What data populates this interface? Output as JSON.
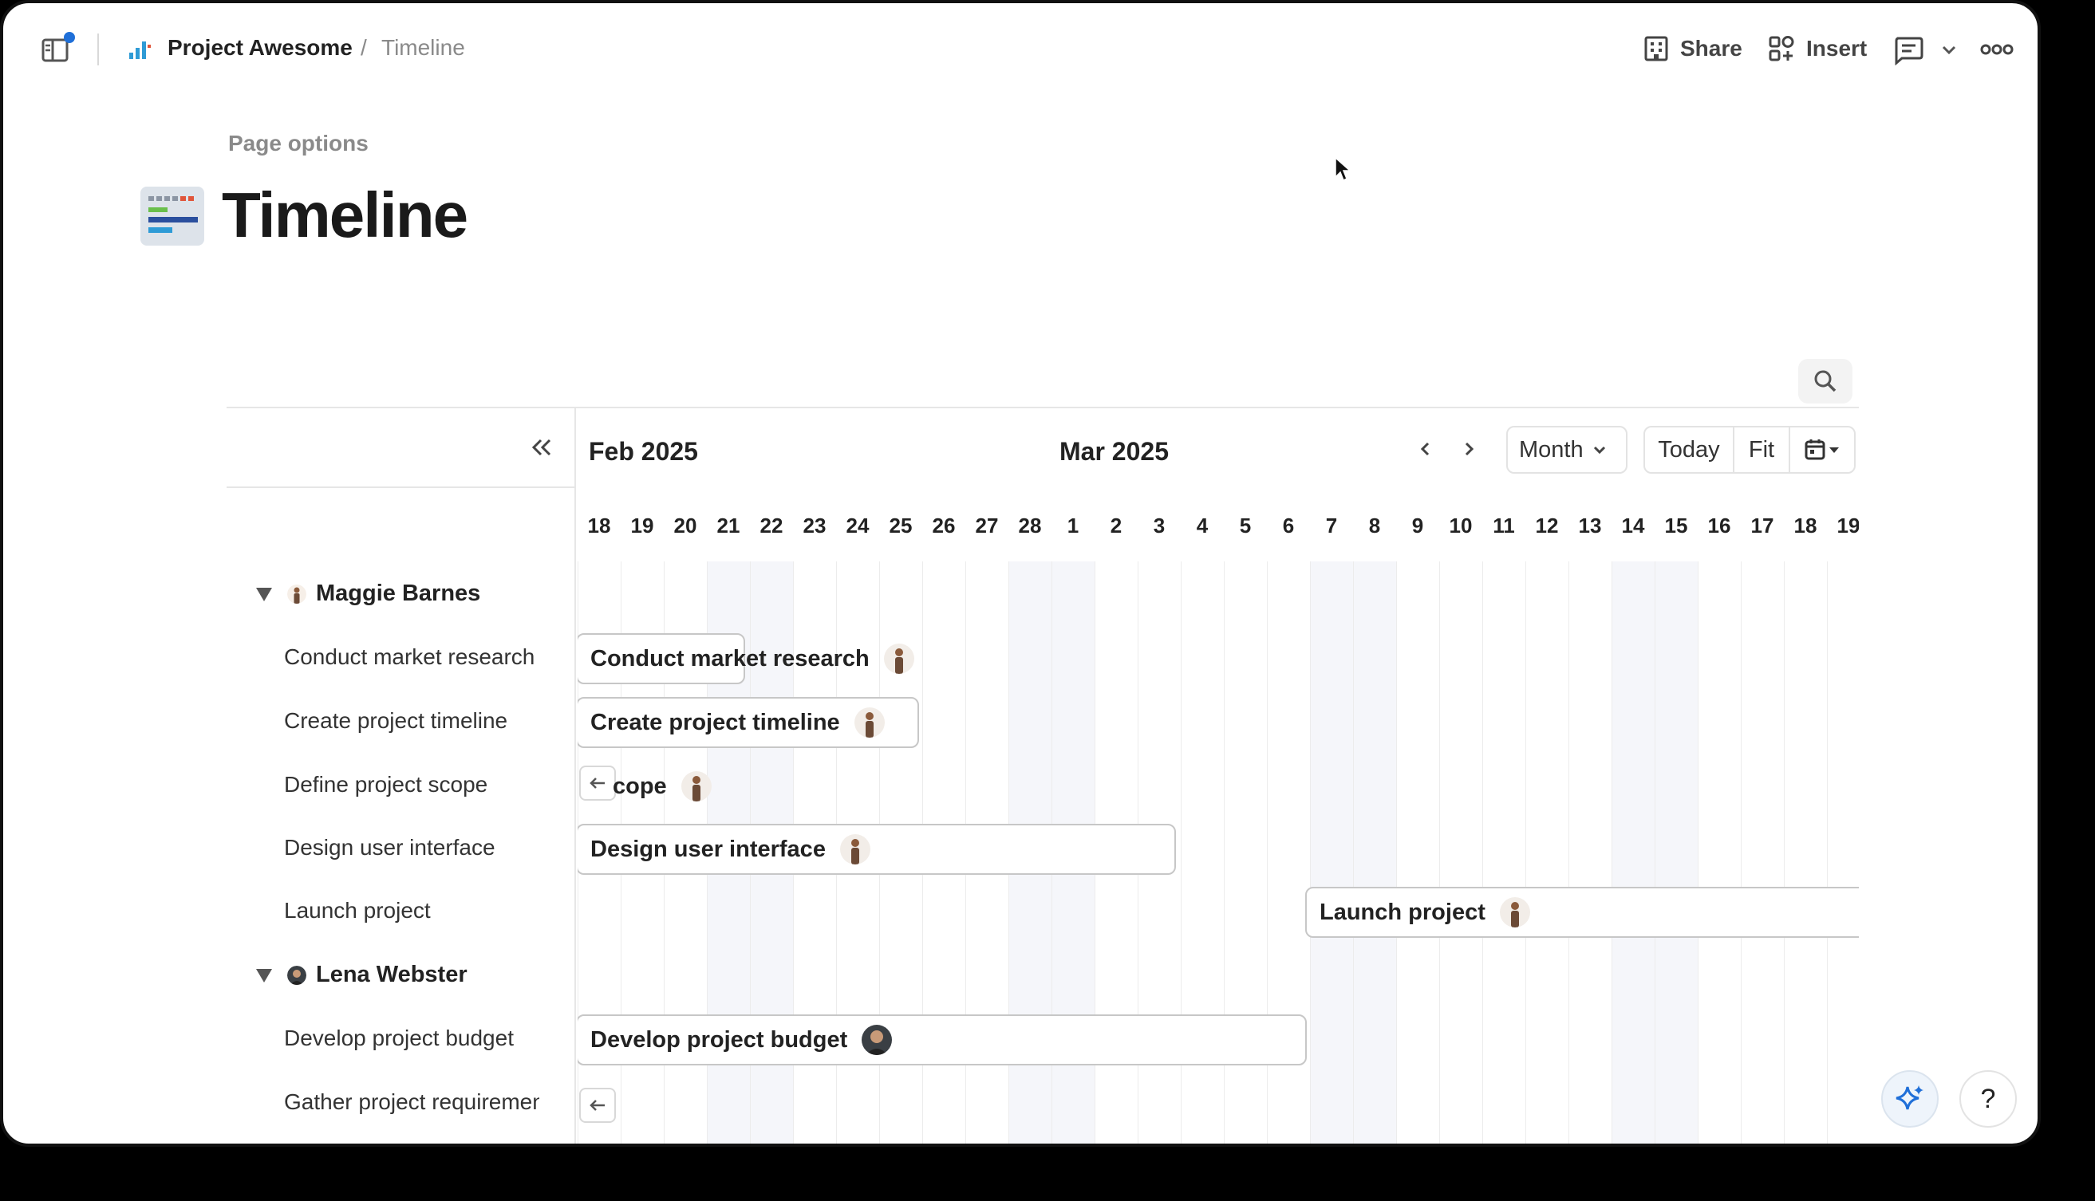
{
  "breadcrumb": {
    "project": "Project Awesome",
    "separator": "/",
    "page": "Timeline"
  },
  "topbar": {
    "share_label": "Share",
    "insert_label": "Insert"
  },
  "page": {
    "options_label": "Page options",
    "title": "Timeline"
  },
  "timeline": {
    "month_left": "Feb 2025",
    "month_right": "Mar 2025",
    "view_select": "Month",
    "today_label": "Today",
    "fit_label": "Fit",
    "days": [
      "18",
      "19",
      "20",
      "21",
      "22",
      "23",
      "24",
      "25",
      "26",
      "27",
      "28",
      "1",
      "2",
      "3",
      "4",
      "5",
      "6",
      "7",
      "8",
      "9",
      "10",
      "11",
      "12",
      "13",
      "14",
      "15",
      "16",
      "17",
      "18",
      "19"
    ],
    "groups": [
      {
        "name": "Maggie Barnes",
        "tasks": [
          "Conduct market research",
          "Create project timeline",
          "Define project scope",
          "Design user interface",
          "Launch project"
        ]
      },
      {
        "name": "Lena Webster",
        "tasks": [
          "Develop project budget",
          "Gather project requirements"
        ]
      }
    ],
    "bars": {
      "conduct": "Conduct market research",
      "create": "Create project timeline",
      "scope": "cope",
      "design": "Design user interface",
      "launch": "Launch project",
      "budget": "Develop project budget"
    }
  },
  "help_label": "?",
  "colors": {
    "accent": "#1f6fd8",
    "weekend": "#f5f6fa",
    "border": "#c7c7c7"
  }
}
